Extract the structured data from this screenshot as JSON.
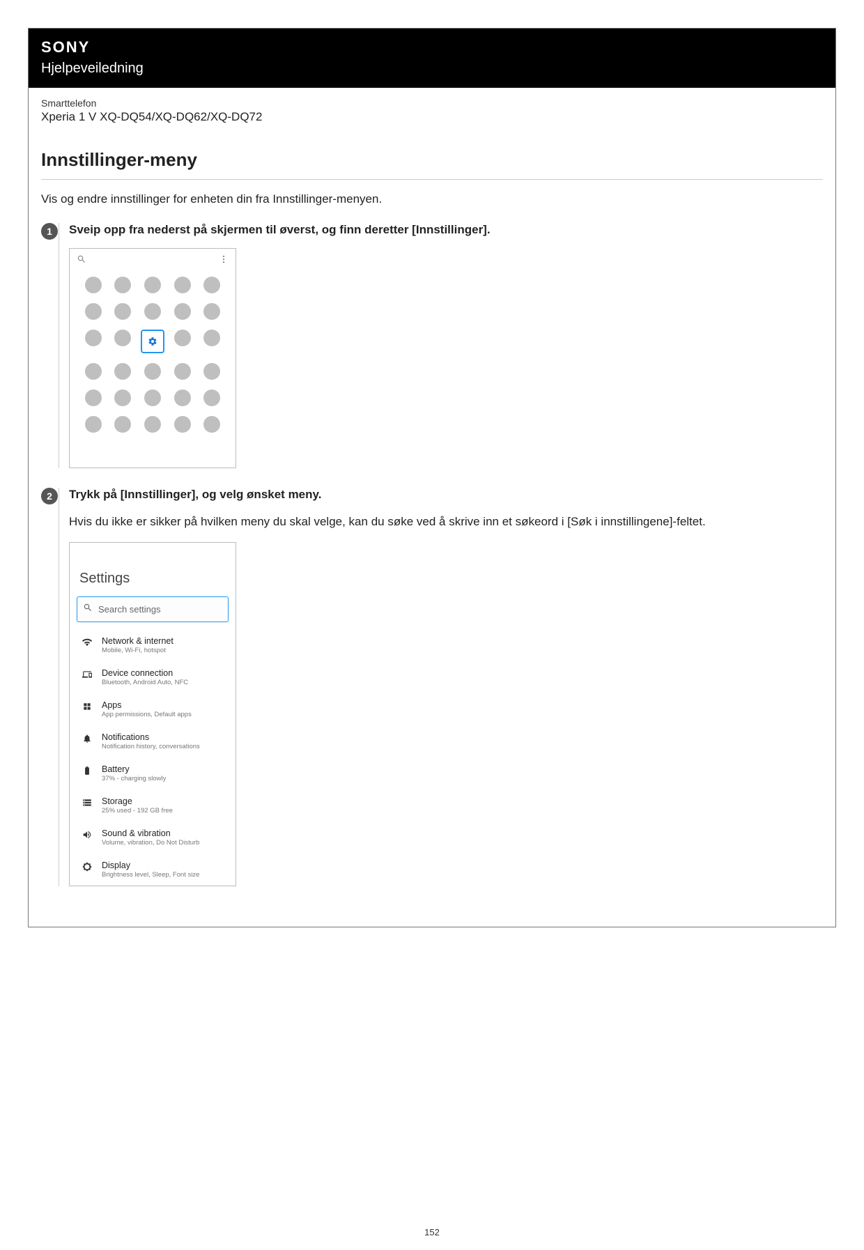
{
  "brand": "SONY",
  "help_guide": "Hjelpeveiledning",
  "device_type": "Smarttelefon",
  "device_model": "Xperia 1 V XQ-DQ54/XQ-DQ62/XQ-DQ72",
  "page_title": "Innstillinger-meny",
  "intro": "Vis og endre innstillinger for enheten din fra Innstillinger-menyen.",
  "step1": {
    "num": "1",
    "title": "Sveip opp fra nederst på skjermen til øverst, og finn deretter [Innstillinger]."
  },
  "step2": {
    "num": "2",
    "title": "Trykk på [Innstillinger], og velg ønsket meny.",
    "text": "Hvis du ikke er sikker på hvilken meny du skal velge, kan du søke ved å skrive inn et søkeord i [Søk i innstillingene]-feltet."
  },
  "settings_shot": {
    "title": "Settings",
    "search_placeholder": "Search settings",
    "rows": [
      {
        "title": "Network & internet",
        "sub": "Mobile, Wi-Fi, hotspot"
      },
      {
        "title": "Device connection",
        "sub": "Bluetooth, Android Auto, NFC"
      },
      {
        "title": "Apps",
        "sub": "App permissions, Default apps"
      },
      {
        "title": "Notifications",
        "sub": "Notification history, conversations"
      },
      {
        "title": "Battery",
        "sub": "37% - charging slowly"
      },
      {
        "title": "Storage",
        "sub": "25% used - 192 GB free"
      },
      {
        "title": "Sound & vibration",
        "sub": "Volume, vibration, Do Not Disturb"
      },
      {
        "title": "Display",
        "sub": "Brightness level, Sleep, Font size"
      }
    ]
  },
  "page_number": "152"
}
